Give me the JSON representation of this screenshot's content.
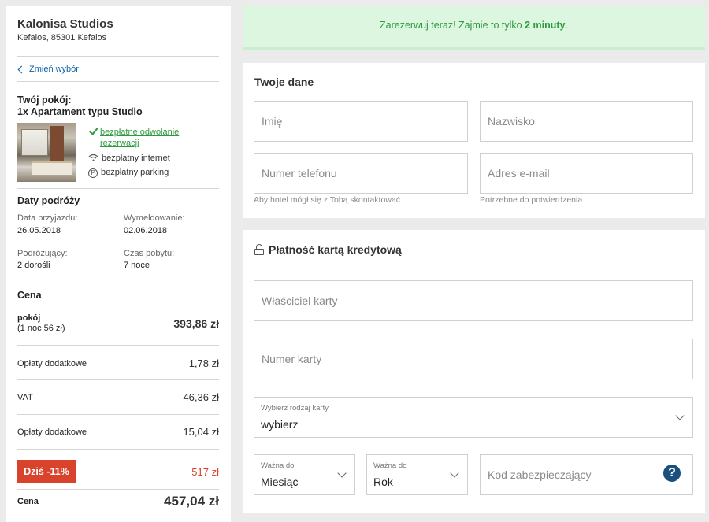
{
  "summary": {
    "hotel_name": "Kalonisa Studios",
    "hotel_address": "Kefalos, 85301 Kefalos",
    "change_link": "Zmień wybór",
    "room_title_line1": "Twój pokój:",
    "room_title_line2": "1x Apartament typu Studio",
    "amenities": {
      "cancel_line1": "bezpłatne odwołanie",
      "cancel_line2": "rezerwacji",
      "internet": "bezpłatny internet",
      "parking": "bezpłatny parking",
      "parking_glyph": "P"
    },
    "travel": {
      "title": "Daty podróży",
      "arrival_label": "Data przyjazdu:",
      "arrival_value": "26.05.2018",
      "checkout_label": "Wymeldowanie:",
      "checkout_value": "02.06.2018",
      "travelers_label": "Podróżujący:",
      "travelers_value": "2 dorośli",
      "duration_label": "Czas pobytu:",
      "duration_value": "7 noce"
    },
    "price": {
      "title": "Cena",
      "room_label": "pokój",
      "room_sublabel": "(1 noc 56 zł)",
      "room_amount": "393,86 zł",
      "rows": [
        {
          "label": "Opłaty dodatkowe",
          "amount": "1,78 zł"
        },
        {
          "label": "VAT",
          "amount": "46,36 zł"
        },
        {
          "label": "Opłaty dodatkowe",
          "amount": "15,04 zł"
        }
      ],
      "discount_badge": "Dziś -11%",
      "old_price": "517 zł",
      "total_label": "Cena",
      "total_amount": "457,04 zł"
    }
  },
  "banner": {
    "text_before": "Zarezerwuj teraz! Zajmie to tylko ",
    "text_bold": "2 minuty",
    "text_after": "."
  },
  "personal": {
    "title": "Twoje dane",
    "first_name_placeholder": "Imię",
    "last_name_placeholder": "Nazwisko",
    "phone_placeholder": "Numer telefonu",
    "email_placeholder": "Adres e-mail",
    "phone_hint": "Aby hotel mógł się z Tobą skontaktować.",
    "email_hint": "Potrzebne do potwierdzenia"
  },
  "payment": {
    "title": "Płatność kartą kredytową",
    "cardholder_placeholder": "Właściciel karty",
    "card_number_placeholder": "Numer karty",
    "card_type_label": "Wybierz rodzaj karty",
    "card_type_value": "wybierz",
    "month_label": "Ważna do",
    "month_value": "Miesiąc",
    "year_label": "Ważna do",
    "year_value": "Rok",
    "cvv_placeholder": "Kod zabezpieczający",
    "help_glyph": "?"
  },
  "colors": {
    "accent_green": "#2e9a3e",
    "banner_bg": "#ddf6df",
    "discount_red": "#d9432c",
    "link_blue": "#0c63a8",
    "help_blue": "#1b4f7d"
  }
}
